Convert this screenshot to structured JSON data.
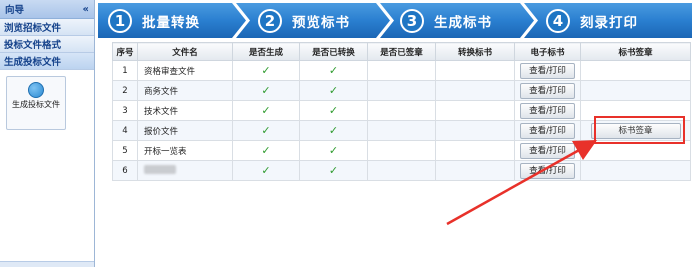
{
  "sidebar": {
    "title": "向导",
    "collapse_icon": "«",
    "items": [
      {
        "label": "浏览招标文件"
      },
      {
        "label": "投标文件格式"
      },
      {
        "label": "生成投标文件"
      }
    ],
    "tile": {
      "label": "生成投标文件",
      "icon": "globe-icon"
    }
  },
  "steps": [
    {
      "num": "1",
      "label": "批量转换"
    },
    {
      "num": "2",
      "label": "预览标书"
    },
    {
      "num": "3",
      "label": "生成标书"
    },
    {
      "num": "4",
      "label": "刻录打印"
    }
  ],
  "table": {
    "headers": [
      "序号",
      "文件名",
      "是否生成",
      "是否已转换",
      "是否已签章",
      "转换标书",
      "电子标书",
      "标书签章"
    ],
    "rows": [
      {
        "index": "1",
        "name": "资格审查文件",
        "generated": true,
        "converted": true,
        "view_label": "查看/打印"
      },
      {
        "index": "2",
        "name": "商务文件",
        "generated": true,
        "converted": true,
        "view_label": "查看/打印"
      },
      {
        "index": "3",
        "name": "技术文件",
        "generated": true,
        "converted": true,
        "view_label": "查看/打印"
      },
      {
        "index": "4",
        "name": "报价文件",
        "generated": true,
        "converted": true,
        "view_label": "查看/打印",
        "sign_label": "标书签章"
      },
      {
        "index": "5",
        "name": "开标一览表",
        "generated": true,
        "converted": true,
        "view_label": "查看/打印"
      },
      {
        "index": "6",
        "name": "",
        "generated": true,
        "converted": true,
        "view_label": "查看/打印",
        "name_redacted": true
      }
    ]
  },
  "colors": {
    "accent": "#1f76c4",
    "highlight": "#e8312a",
    "check": "#2f9b2f"
  }
}
